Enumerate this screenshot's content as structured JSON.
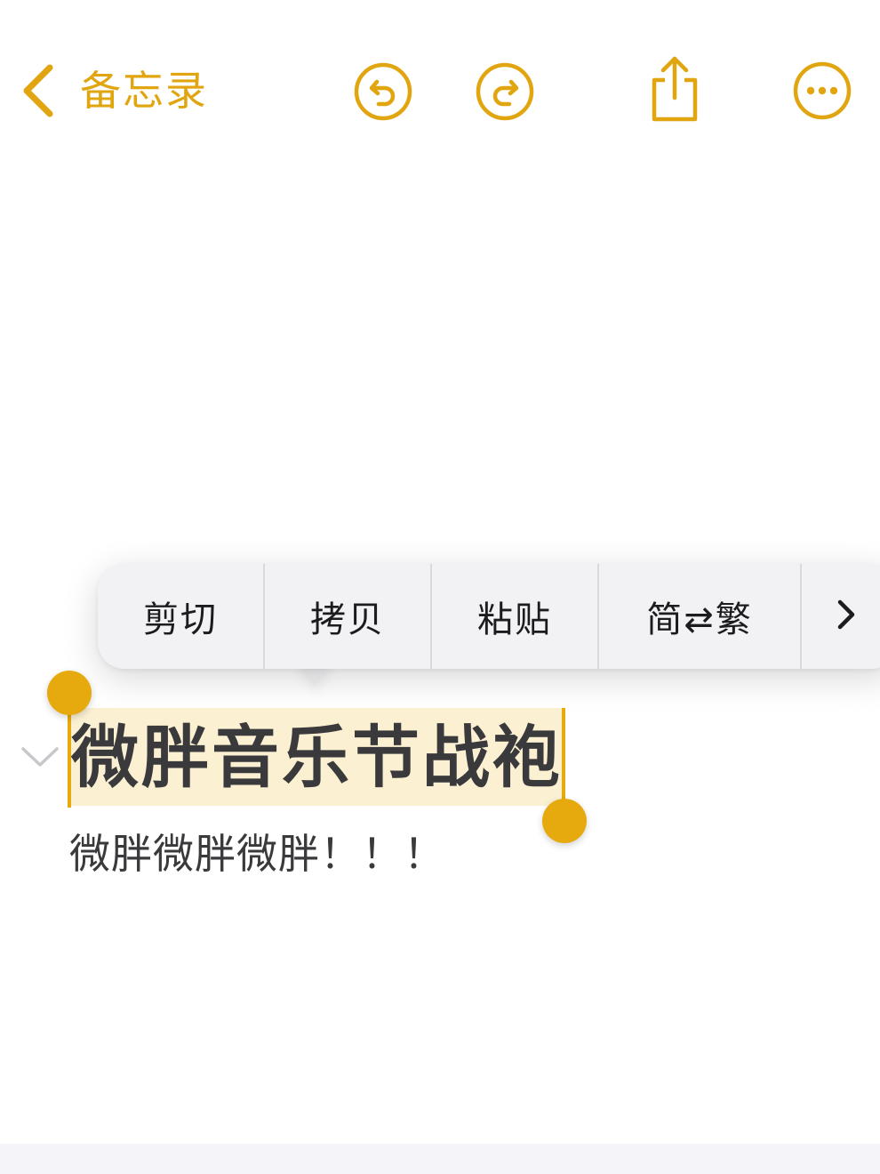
{
  "nav": {
    "back_label": "备忘录",
    "accent_color": "#e0a50f",
    "icons": [
      "chevron-left-icon",
      "undo-icon",
      "redo-icon",
      "share-icon",
      "more-icon"
    ]
  },
  "context_menu": {
    "items": [
      {
        "label": "剪切"
      },
      {
        "label": "拷贝"
      },
      {
        "label": "粘贴"
      },
      {
        "label": "简⇄繁"
      }
    ],
    "more_icon": "chevron-right-icon"
  },
  "note": {
    "title": "微胖音乐节战袍",
    "body": "微胖微胖微胖！！！",
    "selection_color": "#fbf0d2",
    "handle_color": "#e6a90e"
  }
}
